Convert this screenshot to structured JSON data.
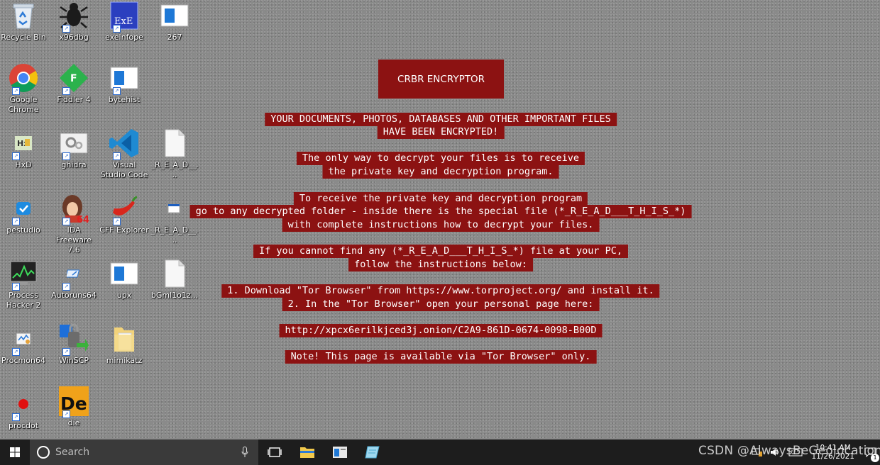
{
  "desktop": {
    "icons": [
      {
        "label": "Recycle Bin"
      },
      {
        "label": "x96dbg"
      },
      {
        "label": "exeinfope"
      },
      {
        "label": "267"
      },
      {
        "label": "Google Chrome"
      },
      {
        "label": "Fiddler 4"
      },
      {
        "label": "bytehist"
      },
      {
        "label": "HxD"
      },
      {
        "label": "ghidra"
      },
      {
        "label": "Visual Studio Code"
      },
      {
        "label": "_R_E_A_D__..."
      },
      {
        "label": "pestudio"
      },
      {
        "label": "IDA Freeware 7.6"
      },
      {
        "label": "CFF Explorer"
      },
      {
        "label": "_R_E_A_D__..."
      },
      {
        "label": "Process Hacker 2"
      },
      {
        "label": "Autoruns64"
      },
      {
        "label": "upx"
      },
      {
        "label": "bGml1o1z..."
      },
      {
        "label": "Procmon64"
      },
      {
        "label": "WinSCP"
      },
      {
        "label": "mimikatz"
      },
      {
        "label": "procdot"
      },
      {
        "label": "die"
      }
    ]
  },
  "note": {
    "title": "CRBR ENCRYPTOR",
    "lines": [
      "YOUR DOCUMENTS, PHOTOS, DATABASES AND OTHER IMPORTANT FILES",
      "HAVE BEEN ENCRYPTED!",
      "The only way to decrypt your files is to receive",
      "the private key and decryption program.",
      "To receive the private key and decryption program",
      "go to any decrypted folder - inside there is the special file (*_R_E_A_D___T_H_I_S_*)",
      "with complete instructions how to decrypt your files.",
      "If you cannot find any (*_R_E_A_D___T_H_I_S_*) file at your PC,",
      "follow the instructions below:",
      "1. Download \"Tor Browser\" from https://www.torproject.org/ and install it.",
      "2. In the \"Tor Browser\" open your personal page here:",
      "http://xpcx6erilkjced3j.onion/C2A9-861D-0674-0098-B00D",
      "Note! This page is available via \"Tor Browser\" only."
    ],
    "color": "#8c1212"
  },
  "taskbar": {
    "search_placeholder": "Search",
    "clock_time": "10:41 AM",
    "clock_date": "11/26/2021",
    "notification_count": "1"
  },
  "watermark": "CSDN @AlwaysBeGeolocation"
}
